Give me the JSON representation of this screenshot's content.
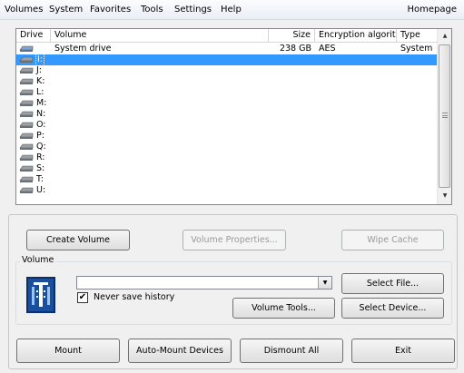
{
  "menu": {
    "items": [
      {
        "label": "Volumes"
      },
      {
        "label": "System"
      },
      {
        "label": "Favorites"
      },
      {
        "label": "Tools"
      },
      {
        "label": "Settings"
      },
      {
        "label": "Help"
      }
    ],
    "homepage": "Homepage"
  },
  "drive_list": {
    "columns": [
      "Drive",
      "Volume",
      "Size",
      "Encryption algorithm",
      "Type"
    ],
    "rows": [
      {
        "drive": "",
        "volume": "System drive",
        "size": "238 GB",
        "algorithm": "AES",
        "type": "System",
        "icon": "system-drive-icon"
      },
      {
        "drive": "I:",
        "volume": "",
        "size": "",
        "algorithm": "",
        "type": "",
        "icon": "drive-icon",
        "selected": true
      },
      {
        "drive": "J:",
        "icon": "drive-icon"
      },
      {
        "drive": "K:",
        "icon": "drive-icon"
      },
      {
        "drive": "L:",
        "icon": "drive-icon"
      },
      {
        "drive": "M:",
        "icon": "drive-icon"
      },
      {
        "drive": "N:",
        "icon": "drive-icon"
      },
      {
        "drive": "O:",
        "icon": "drive-icon"
      },
      {
        "drive": "P:",
        "icon": "drive-icon"
      },
      {
        "drive": "Q:",
        "icon": "drive-icon"
      },
      {
        "drive": "R:",
        "icon": "drive-icon"
      },
      {
        "drive": "S:",
        "icon": "drive-icon"
      },
      {
        "drive": "T:",
        "icon": "drive-icon"
      },
      {
        "drive": "U:",
        "icon": "drive-icon"
      }
    ]
  },
  "buttons": {
    "create_volume": "Create Volume",
    "volume_properties": "Volume Properties...",
    "wipe_cache": "Wipe Cache",
    "select_file": "Select File...",
    "volume_tools": "Volume Tools...",
    "select_device": "Select Device...",
    "mount": "Mount",
    "auto_mount": "Auto-Mount Devices",
    "dismount_all": "Dismount All",
    "exit": "Exit"
  },
  "volume_group": {
    "label": "Volume",
    "path_value": "",
    "never_save_history_label": "Never save history",
    "never_save_history_checked": true
  },
  "colors": {
    "selection": "#3399ff",
    "logo": "#1a4f9e"
  }
}
